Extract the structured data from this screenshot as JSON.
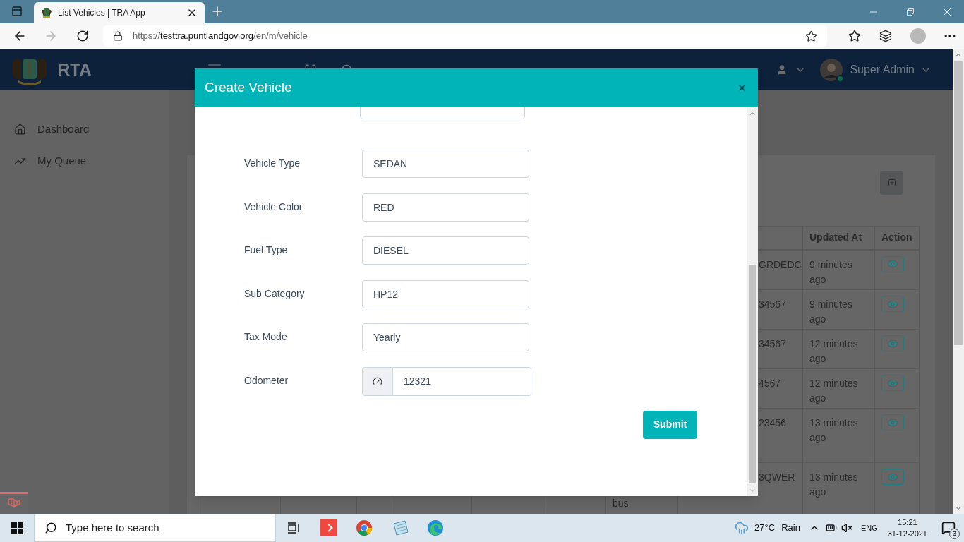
{
  "browser": {
    "tab_title": "List Vehicles | TRA App",
    "url_scheme": "https://",
    "url_host": "testtra.puntlandgov.org",
    "url_path": "/en/m/vehicle"
  },
  "app": {
    "brand": "RTA",
    "user_name": "Super Admin",
    "user_online": true
  },
  "sidebar": {
    "items": [
      {
        "kind": "home",
        "label": "Dashboard"
      },
      {
        "kind": "trend",
        "label": "My Queue"
      }
    ]
  },
  "table": {
    "columns": [
      "Updated At",
      "Action"
    ],
    "rows": [
      {
        "column_8": "GRDEDC",
        "updated_at": "9 minutes ago"
      },
      {
        "column_8": "34567",
        "updated_at": "9 minutes ago"
      },
      {
        "column_8": "34567",
        "updated_at": "12 minutes ago"
      },
      {
        "column_8": "4567",
        "updated_at": "12 minutes ago"
      },
      {
        "column_8": "23456",
        "updated_at": "13 minutes ago"
      },
      {
        "column_7": "bus",
        "column_8": "3QWER",
        "updated_at": "13 minutes ago"
      }
    ]
  },
  "modal": {
    "title": "Create Vehicle",
    "fields": [
      {
        "kind": "text"
      },
      {
        "kind": "text",
        "label": "Vehicle Type",
        "value": "SEDAN"
      },
      {
        "kind": "text",
        "label": "Vehicle Color",
        "value": "RED"
      },
      {
        "kind": "text",
        "label": "Fuel Type",
        "value": "DIESEL"
      },
      {
        "kind": "text",
        "label": "Sub Category",
        "value": "HP12"
      },
      {
        "kind": "text",
        "label": "Tax Mode",
        "value": "Yearly"
      },
      {
        "kind": "addon",
        "label": "Odometer",
        "value": "12321"
      }
    ],
    "submit": "Submit"
  },
  "taskbar": {
    "search_placeholder": "Type here to search",
    "temperature": "27°C",
    "weather": "Rain",
    "language": "ENG",
    "time": "15:21",
    "date": "31-12-2021",
    "notifications": "3"
  }
}
